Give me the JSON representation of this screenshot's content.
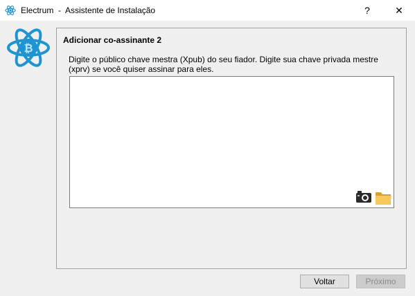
{
  "window": {
    "title": "Electrum  -  Assistente de Instalação",
    "help_label": "?",
    "close_label": "✕"
  },
  "logo": {
    "icon": "electrum-bitcoin-atom-logo",
    "accent_color": "#1e94d2"
  },
  "panel": {
    "title": "Adicionar co-assinante 2",
    "description": "Digite o público chave mestra (Xpub) do seu fiador. Digite sua chave privada mestre (xprv) se você quiser assinar para eles.",
    "input_value": "",
    "icons": [
      "camera-icon",
      "folder-icon"
    ]
  },
  "footer": {
    "back_label": "Voltar",
    "next_label": "Próximo",
    "next_enabled": false
  }
}
